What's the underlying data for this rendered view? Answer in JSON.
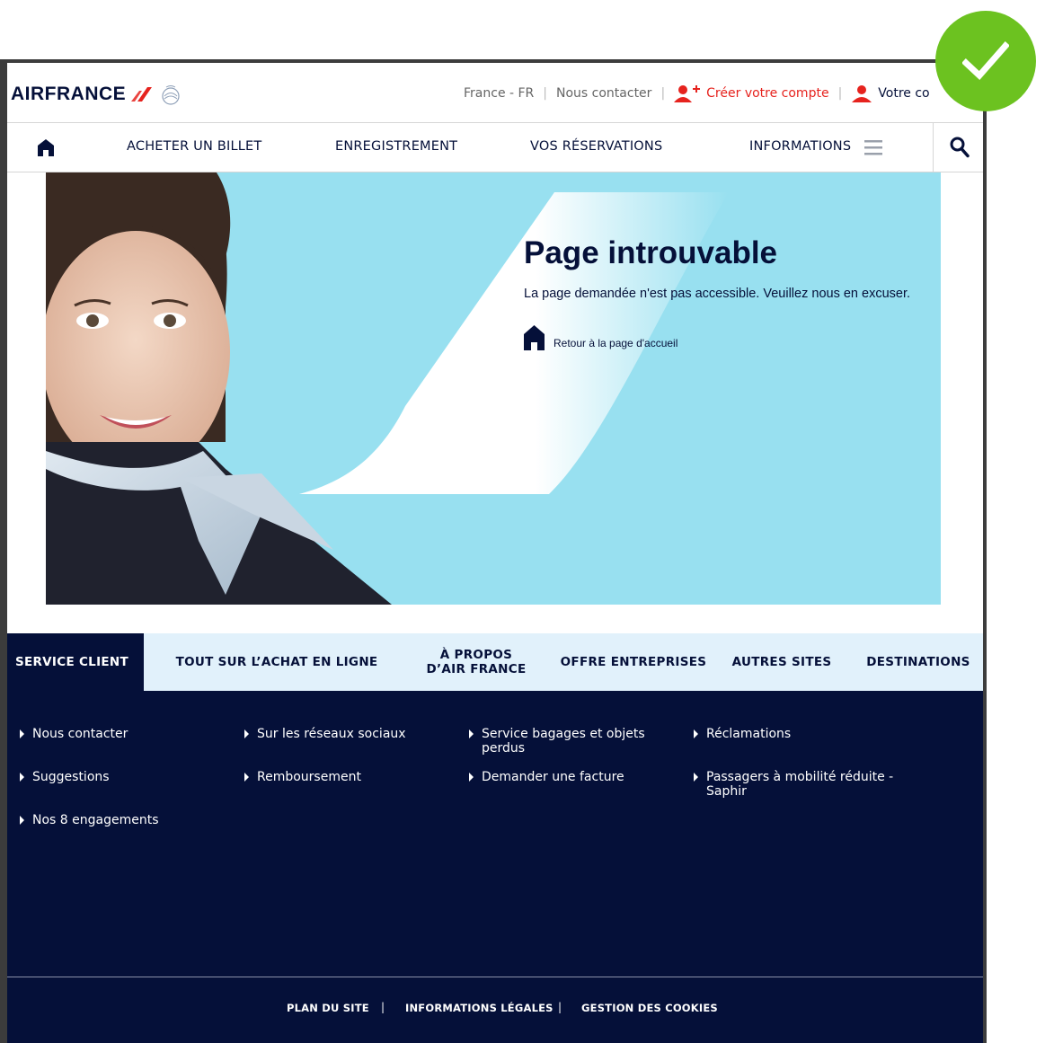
{
  "brand": {
    "name": "AIRFRANCE",
    "color": "#051039",
    "accent": "#e6231e"
  },
  "topbar": {
    "locale": "France - FR",
    "contact": "Nous contacter",
    "create_account": "Créer votre compte",
    "account": "Votre co"
  },
  "nav": {
    "items": [
      "ACHETER UN BILLET",
      "ENREGISTREMENT",
      "VOS RÉSERVATIONS",
      "INFORMATIONS"
    ]
  },
  "hero": {
    "title": "Page introuvable",
    "subtitle": "La page demandée n'est pas accessible. Veuillez nous en excuser.",
    "back_link": "Retour à la page d'accueil",
    "background": "#98e0f0"
  },
  "footer": {
    "tabs": [
      "SERVICE CLIENT",
      "TOUT SUR L’ACHAT EN LIGNE",
      "À PROPOS",
      "D’AIR FRANCE",
      "OFFRE ENTREPRISES",
      "AUTRES SITES",
      "DESTINATIONS"
    ],
    "links": [
      "Nous contacter",
      "Sur les réseaux sociaux",
      "Service bagages et objets",
      "perdus",
      "Réclamations",
      "Suggestions",
      "Remboursement",
      "Demander une facture",
      "Passagers à mobilité réduite -",
      "Saphir",
      "Nos 8 engagements"
    ],
    "bottom": [
      "PLAN DU SITE",
      "INFORMATIONS LÉGALES",
      "GESTION DES COOKIES"
    ],
    "separator": "|",
    "background": "#051039"
  },
  "badge": {
    "icon": "checkmark-icon",
    "color": "#6cc220"
  }
}
